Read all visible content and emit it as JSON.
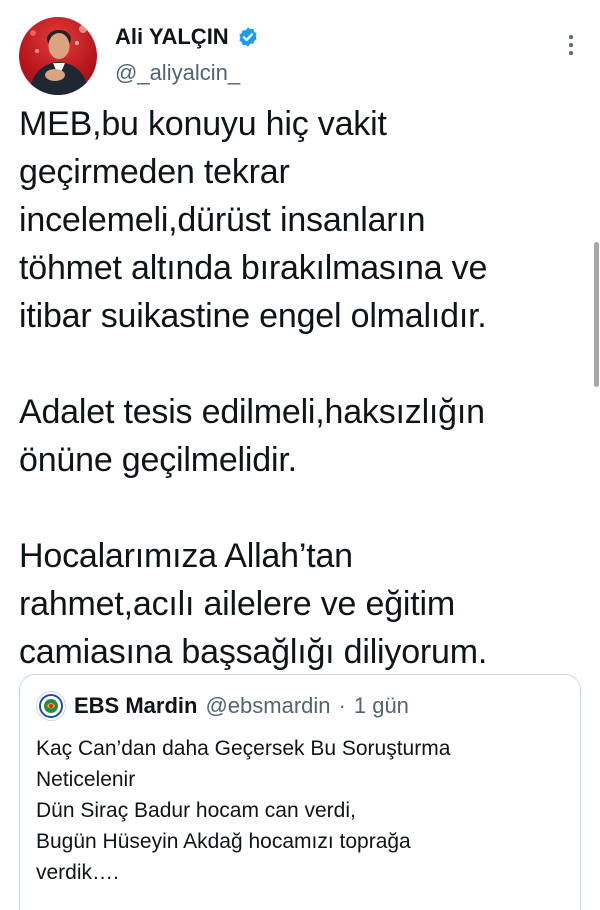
{
  "author": {
    "display_name": "Ali YALÇIN",
    "handle": "@_aliyalcin_",
    "verified_icon": "verified-badge-icon",
    "accent_color": "#1d9bf0"
  },
  "tweet": {
    "paragraphs": [
      [
        "MEB,bu konuyu hiç vakit",
        "geçirmeden tekrar",
        "incelemeli,dürüst insanların",
        "töhmet altında bırakılmasına ve",
        "itibar suikastine engel olmalıdır."
      ],
      [
        "Adalet tesis edilmeli,haksızlığın",
        "önüne geçilmelidir."
      ],
      [
        "Hocalarımıza Allah’tan",
        "rahmet,acılı ailelere ve eğitim",
        "camiasına başsağlığı diliyorum."
      ]
    ]
  },
  "quoted_tweet": {
    "display_name": "EBS Mardin",
    "handle": "@ebsmardin",
    "separator": "·",
    "time": "1 gün",
    "lines": [
      "Kaç Can’dan daha Geçersek Bu Soruşturma",
      "Neticelenir",
      "Dün Siraç Badur hocam can verdi,",
      "Bugün Hüseyin Akdağ hocamızı toprağa",
      "verdik…."
    ]
  }
}
